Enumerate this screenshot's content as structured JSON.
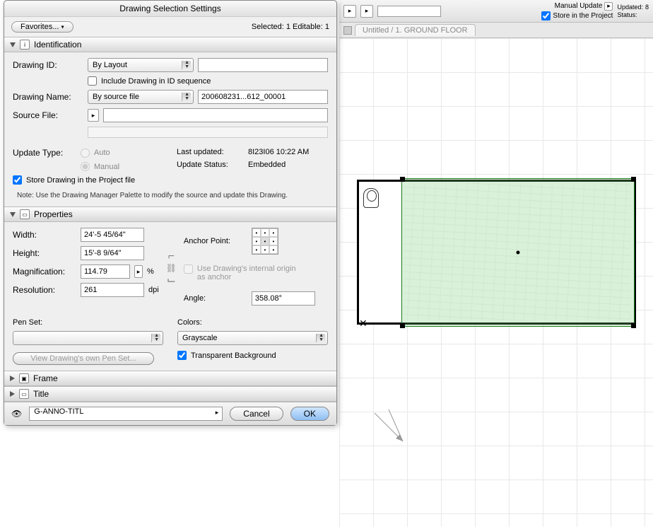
{
  "dialog": {
    "title": "Drawing Selection Settings",
    "favorites_label": "Favorites...",
    "selected_text": "Selected: 1 Editable: 1"
  },
  "identification": {
    "header": "Identification",
    "drawing_id_label": "Drawing ID:",
    "drawing_id_mode": "By Layout",
    "drawing_id_value": "",
    "include_seq_label": "Include Drawing in ID sequence",
    "drawing_name_label": "Drawing Name:",
    "drawing_name_mode": "By source file",
    "drawing_name_value": "200608231...612_00001",
    "source_file_label": "Source File:",
    "source_file_value": "",
    "update_type_label": "Update Type:",
    "auto_label": "Auto",
    "manual_label": "Manual",
    "last_updated_label": "Last updated:",
    "last_updated_value": "8I23I06 10:22 AM",
    "update_status_label": "Update Status:",
    "update_status_value": "Embedded",
    "store_label": "Store Drawing in the Project file",
    "note": "Note:  Use the Drawing Manager Palette to modify the source and update this Drawing."
  },
  "properties": {
    "header": "Properties",
    "width_label": "Width:",
    "width_value": "24'-5 45/64\"",
    "height_label": "Height:",
    "height_value": "15'-8 9/64\"",
    "mag_label": "Magnification:",
    "mag_value": "114.79",
    "mag_unit": "%",
    "res_label": "Resolution:",
    "res_value": "261",
    "res_unit": "dpi",
    "anchor_label": "Anchor Point:",
    "internal_origin_label": "Use Drawing's internal origin as anchor",
    "angle_label": "Angle:",
    "angle_value": "358.08°",
    "penset_label": "Pen Set:",
    "penset_value": "",
    "view_own_label": "View Drawing's own Pen Set...",
    "colors_label": "Colors:",
    "colors_value": "Grayscale",
    "transparent_label": "Transparent Background"
  },
  "collapsed": {
    "frame": "Frame",
    "title": "Title"
  },
  "footer": {
    "layer": "G-ANNO-TITL",
    "cancel": "Cancel",
    "ok": "OK"
  },
  "canvas": {
    "manual_update": "Manual Update",
    "updated_label": "Updated:",
    "updated_value": "8",
    "store_project": "Store in the Project",
    "status_label": "Status:",
    "tab_title": "Untitled / 1. GROUND FLOOR"
  }
}
